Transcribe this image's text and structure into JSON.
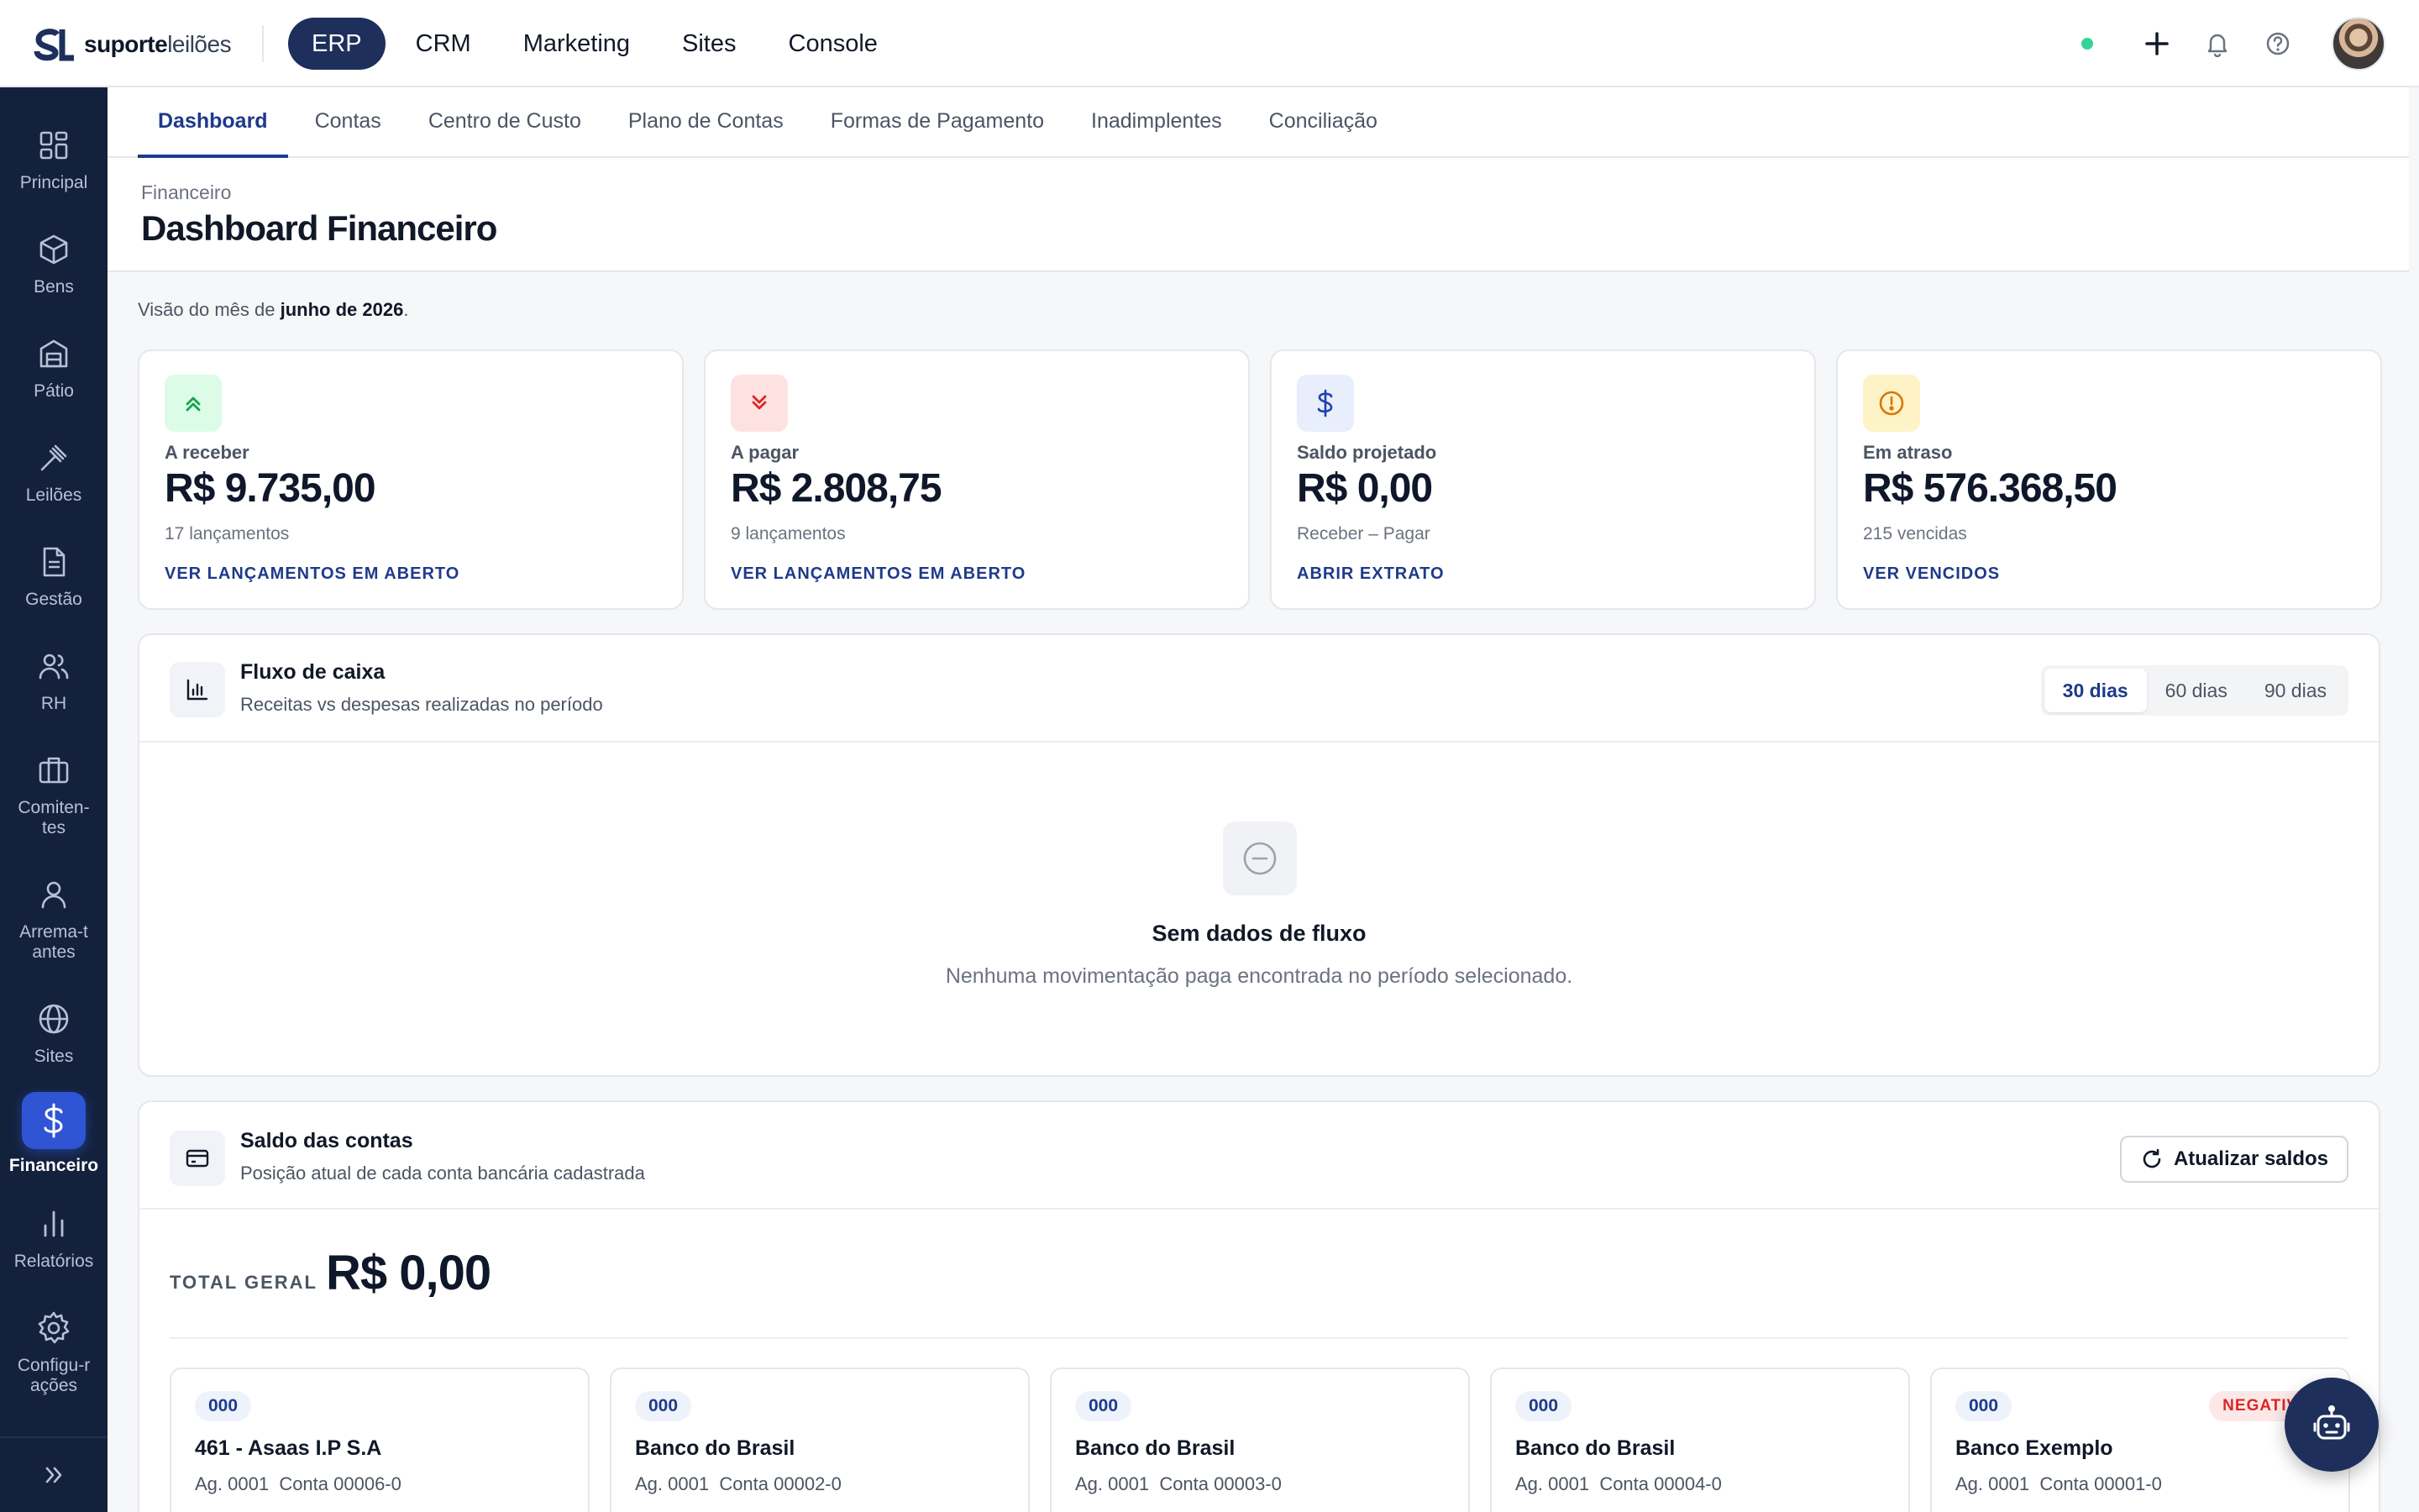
{
  "brand": {
    "name_bold": "suporte",
    "name_light": "leilões"
  },
  "topnav": [
    {
      "label": "ERP",
      "active": true
    },
    {
      "label": "CRM"
    },
    {
      "label": "Marketing"
    },
    {
      "label": "Sites"
    },
    {
      "label": "Console"
    }
  ],
  "sidebar": [
    {
      "label": "Principal",
      "icon": "grid-icon"
    },
    {
      "label": "Bens",
      "icon": "box-icon"
    },
    {
      "label": "Pátio",
      "icon": "warehouse-icon"
    },
    {
      "label": "Leilões",
      "icon": "gavel-icon"
    },
    {
      "label": "Gestão",
      "icon": "document-icon"
    },
    {
      "label": "RH",
      "icon": "users-icon"
    },
    {
      "label": "Comiten-tes",
      "icon": "briefcase-icon"
    },
    {
      "label": "Arrema-tantes",
      "icon": "user-icon"
    },
    {
      "label": "Sites",
      "icon": "globe-icon"
    },
    {
      "label": "Financeiro",
      "icon": "dollar-icon",
      "active": true
    },
    {
      "label": "Relatórios",
      "icon": "bar-chart-icon"
    },
    {
      "label": "Configu-rações",
      "icon": "gear-icon"
    }
  ],
  "tabs": [
    {
      "label": "Dashboard",
      "active": true
    },
    {
      "label": "Contas"
    },
    {
      "label": "Centro de Custo"
    },
    {
      "label": "Plano de Contas"
    },
    {
      "label": "Formas de Pagamento"
    },
    {
      "label": "Inadimplentes"
    },
    {
      "label": "Conciliação"
    }
  ],
  "page": {
    "breadcrumb": "Financeiro",
    "title": "Dashboard Financeiro"
  },
  "vision": {
    "prefix": "Visão do mês de ",
    "month": "junho de 2026",
    "suffix": "."
  },
  "kpis": [
    {
      "label": "A receber",
      "value": "R$ 9.735,00",
      "sub": "17 lançamentos",
      "link": "VER LANÇAMENTOS EM ABERTO",
      "icon": "chevrons-up-icon",
      "bg": "#dcfce7",
      "fg": "#16a34a"
    },
    {
      "label": "A pagar",
      "value": "R$ 2.808,75",
      "sub": "9 lançamentos",
      "link": "VER LANÇAMENTOS EM ABERTO",
      "icon": "chevrons-down-icon",
      "bg": "#fee2e2",
      "fg": "#dc2626"
    },
    {
      "label": "Saldo projetado",
      "value": "R$ 0,00",
      "sub": "Receber – Pagar",
      "link": "ABRIR EXTRATO",
      "icon": "dollar-icon",
      "bg": "#e8eefb",
      "fg": "#1e40af"
    },
    {
      "label": "Em atraso",
      "value": "R$ 576.368,50",
      "sub": "215 vencidas",
      "link": "VER VENCIDOS",
      "icon": "alert-circle-icon",
      "bg": "#fef3c7",
      "fg": "#d97706"
    }
  ],
  "cashflow": {
    "title": "Fluxo de caixa",
    "subtitle": "Receitas vs despesas realizadas no período",
    "ranges": [
      "30 dias",
      "60 dias",
      "90 dias"
    ],
    "active_range": "30 dias",
    "empty_title": "Sem dados de fluxo",
    "empty_sub": "Nenhuma movimentação paga encontrada no período selecionado."
  },
  "balances": {
    "title": "Saldo das contas",
    "subtitle": "Posição atual de cada conta bancária cadastrada",
    "refresh_label": "Atualizar saldos",
    "total_label": "TOTAL GERAL",
    "total_value": "R$ 0,00",
    "accounts": [
      {
        "code": "000",
        "name": "461 - Asaas I.P S.A",
        "agency": "Ag. 0001",
        "account": "Conta 00006-0"
      },
      {
        "code": "000",
        "name": "Banco do Brasil",
        "agency": "Ag. 0001",
        "account": "Conta 00002-0"
      },
      {
        "code": "000",
        "name": "Banco do Brasil",
        "agency": "Ag. 0001",
        "account": "Conta 00003-0"
      },
      {
        "code": "000",
        "name": "Banco do Brasil",
        "agency": "Ag. 0001",
        "account": "Conta 00004-0"
      },
      {
        "code": "000",
        "name": "Banco Exemplo",
        "agency": "Ag. 0001",
        "account": "Conta 00001-0",
        "badge": "NEGATIVO"
      }
    ]
  },
  "colors": {
    "brand_navy": "#1e2f5c",
    "sidebar": "#14213d",
    "accent": "#2f55d4",
    "link": "#1e3a8a"
  }
}
